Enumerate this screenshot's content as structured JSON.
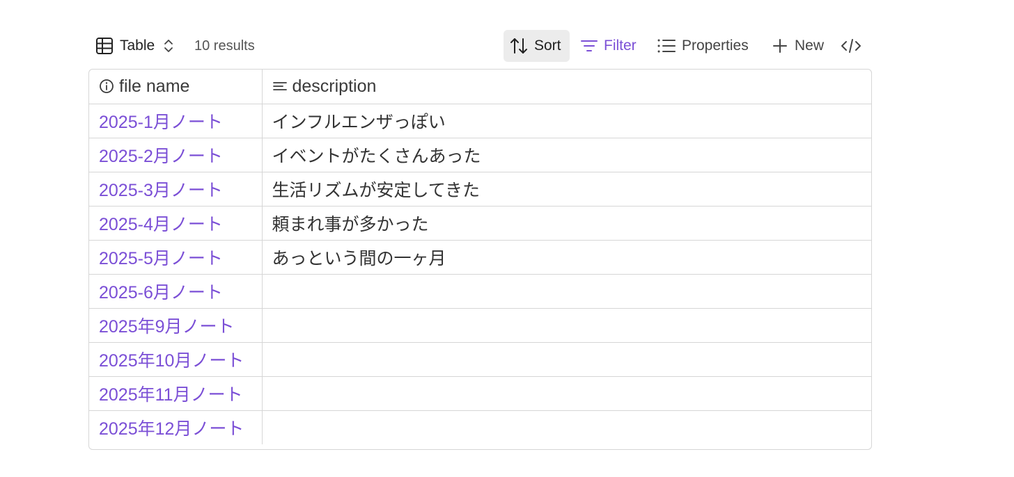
{
  "toolbar": {
    "view_label": "Table",
    "results_count": "10 results",
    "sort_label": "Sort",
    "filter_label": "Filter",
    "properties_label": "Properties",
    "new_label": "New",
    "icons": {
      "view": "table-grid-icon",
      "view_toggle": "chevron-up-down-icon",
      "sort": "sort-arrows-icon",
      "filter": "filter-lines-icon",
      "properties": "list-icon",
      "new": "plus-icon",
      "embed": "code-icon"
    }
  },
  "table": {
    "columns": [
      {
        "label": "file name",
        "icon": "info-circle-icon"
      },
      {
        "label": "description",
        "icon": "text-lines-icon"
      }
    ],
    "rows": [
      {
        "file_name": "2025-1月ノート",
        "description": "インフルエンザっぽい"
      },
      {
        "file_name": "2025-2月ノート",
        "description": "イベントがたくさんあった"
      },
      {
        "file_name": "2025-3月ノート",
        "description": "生活リズムが安定してきた"
      },
      {
        "file_name": "2025-4月ノート",
        "description": "頼まれ事が多かった"
      },
      {
        "file_name": "2025-5月ノート",
        "description": "あっという間の一ヶ月"
      },
      {
        "file_name": "2025-6月ノート",
        "description": ""
      },
      {
        "file_name": "2025年9月ノート",
        "description": ""
      },
      {
        "file_name": "2025年10月ノート",
        "description": ""
      },
      {
        "file_name": "2025年11月ノート",
        "description": ""
      },
      {
        "file_name": "2025年12月ノート",
        "description": ""
      }
    ]
  },
  "colors": {
    "link": "#7b4fd6",
    "filter_active": "#7b4fd6",
    "sort_active_bg": "#ececec",
    "border": "#d6d6d6"
  }
}
